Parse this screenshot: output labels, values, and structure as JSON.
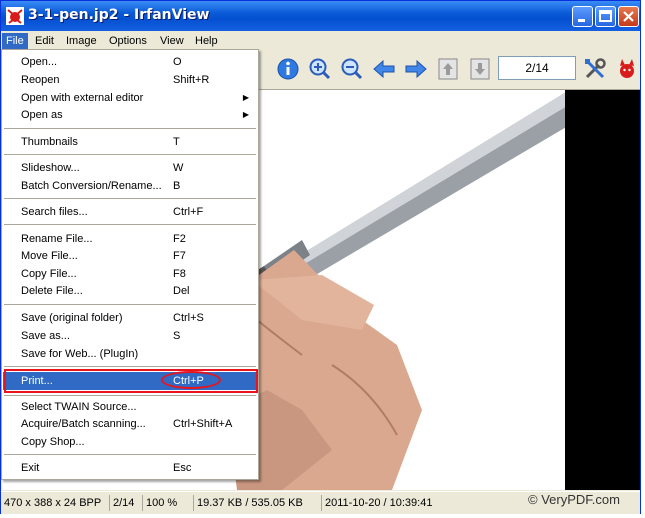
{
  "window": {
    "title": "3-1-pen.jp2 - IrfanView"
  },
  "menubar": {
    "items": [
      "File",
      "Edit",
      "Image",
      "Options",
      "View",
      "Help"
    ]
  },
  "toolbar": {
    "counter": "2/14"
  },
  "file_menu": {
    "items": [
      {
        "label": "Open...",
        "shortcut": "O"
      },
      {
        "label": "Reopen",
        "shortcut": "Shift+R"
      },
      {
        "label": "Open with external editor",
        "shortcut": ""
      },
      {
        "label": "Open as",
        "shortcut": ""
      },
      {
        "label": "Thumbnails",
        "shortcut": "T"
      },
      {
        "label": "Slideshow...",
        "shortcut": "W"
      },
      {
        "label": "Batch Conversion/Rename...",
        "shortcut": "B"
      },
      {
        "label": "Search files...",
        "shortcut": "Ctrl+F"
      },
      {
        "label": "Rename File...",
        "shortcut": "F2"
      },
      {
        "label": "Move File...",
        "shortcut": "F7"
      },
      {
        "label": "Copy File...",
        "shortcut": "F8"
      },
      {
        "label": "Delete File...",
        "shortcut": "Del"
      },
      {
        "label": "Save (original folder)",
        "shortcut": "Ctrl+S"
      },
      {
        "label": "Save as...",
        "shortcut": "S"
      },
      {
        "label": "Save for Web... (PlugIn)",
        "shortcut": ""
      },
      {
        "label": "Print...",
        "shortcut": "Ctrl+P"
      },
      {
        "label": "Select TWAIN Source...",
        "shortcut": ""
      },
      {
        "label": "Acquire/Batch scanning...",
        "shortcut": "Ctrl+Shift+A"
      },
      {
        "label": "Copy Shop...",
        "shortcut": ""
      },
      {
        "label": "Exit",
        "shortcut": "Esc"
      }
    ]
  },
  "statusbar": {
    "dimensions": "470 x 388 x 24 BPP",
    "index": "2/14",
    "zoom": "100 %",
    "size": "19.37 KB / 535.05 KB",
    "datetime": "2011-10-20 / 10:39:41"
  },
  "watermark": "© VeryPDF.com"
}
